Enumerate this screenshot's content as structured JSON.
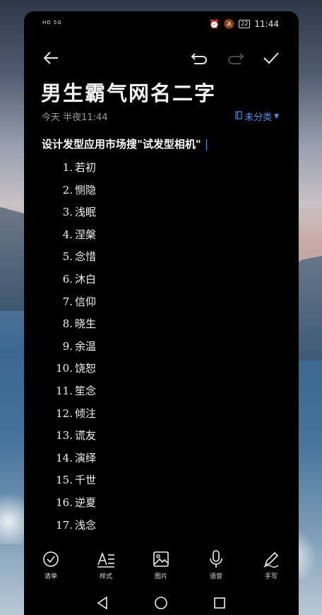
{
  "status_bar": {
    "network_text": "HD 5G",
    "battery": "22",
    "time": "11:44"
  },
  "toolbar": {
    "back_icon": "arrow-left-icon",
    "undo_icon": "undo-icon",
    "redo_icon": "redo-icon",
    "done_icon": "check-icon"
  },
  "note": {
    "title": "男生霸气网名二字",
    "meta": "今天  半夜11:44",
    "category": "未分类",
    "headline": "设计发型应用市场搜\"试发型相机\"",
    "items": [
      {
        "num": "1.",
        "text": "若初"
      },
      {
        "num": "2.",
        "text": "恻隐"
      },
      {
        "num": "3.",
        "text": "浅眠"
      },
      {
        "num": "4.",
        "text": "涅槃"
      },
      {
        "num": "5.",
        "text": "念惜"
      },
      {
        "num": "6.",
        "text": "沐白"
      },
      {
        "num": "7.",
        "text": "信仰"
      },
      {
        "num": "8.",
        "text": "晓生"
      },
      {
        "num": "9.",
        "text": "余温"
      },
      {
        "num": "10.",
        "text": "饶恕"
      },
      {
        "num": "11.",
        "text": "笙念"
      },
      {
        "num": "12.",
        "text": "倾注"
      },
      {
        "num": "13.",
        "text": "谎友"
      },
      {
        "num": "14.",
        "text": "演绎"
      },
      {
        "num": "15.",
        "text": "千世"
      },
      {
        "num": "16.",
        "text": "逆夏"
      },
      {
        "num": "17.",
        "text": "浅念"
      }
    ]
  },
  "bottom_bar": {
    "checklist": "清单",
    "style": "样式",
    "image": "图片",
    "voice": "语音",
    "handwriting": "手写"
  },
  "colors": {
    "accent": "#4d8fe8",
    "background": "#000000"
  }
}
